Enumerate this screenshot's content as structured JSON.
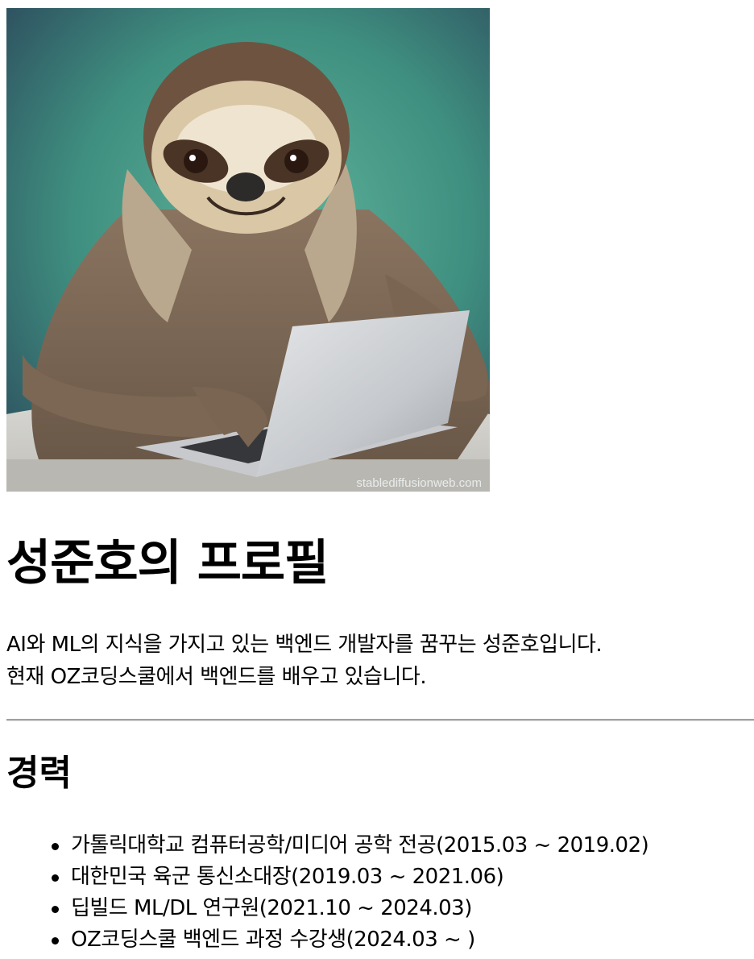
{
  "profile": {
    "image_alt": "sloth with laptop",
    "watermark": "stablediffusionweb.com",
    "title": "성준호의 프로필",
    "intro_lines": [
      "AI와 ML의 지식을 가지고 있는 백엔드 개발자를 꿈꾸는 성준호입니다.",
      "현재 OZ코딩스쿨에서 백엔드를 배우고 있습니다."
    ]
  },
  "career": {
    "heading": "경력",
    "items": [
      "가톨릭대학교 컴퓨터공학/미디어 공학 전공(2015.03 ~ 2019.02)",
      "대한민국 육군 통신소대장(2019.03 ~ 2021.06)",
      "딥빌드 ML/DL 연구원(2021.10 ~ 2024.03)",
      "OZ코딩스쿨 백엔드 과정 수강생(2024.03 ~ )"
    ]
  },
  "colors": {
    "background": "#ffffff",
    "text": "#000000",
    "divider": "#a0a0a0"
  }
}
